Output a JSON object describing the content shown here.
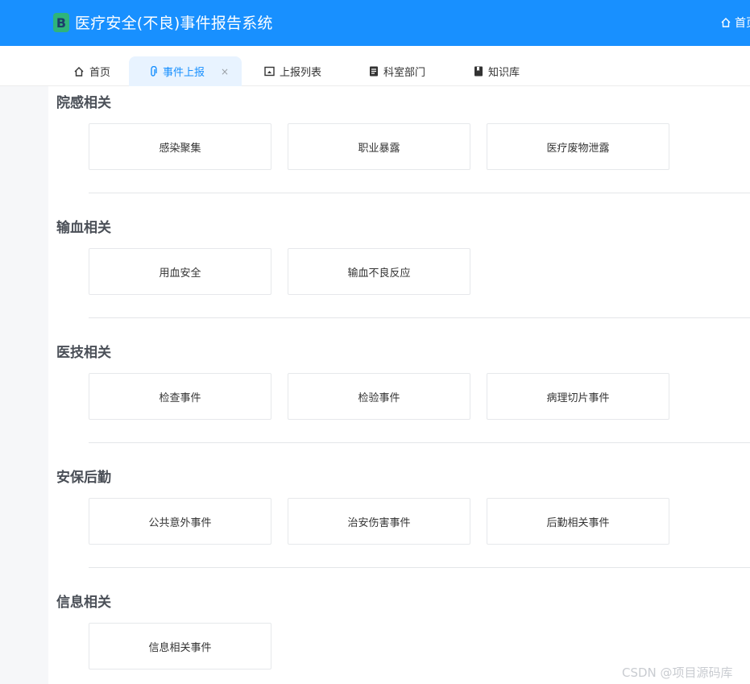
{
  "header": {
    "logo_letter": "B",
    "title": "医疗安全(不良)事件报告系统",
    "home_label": "首页"
  },
  "tabs": [
    {
      "label": "首页",
      "icon": "home-icon"
    },
    {
      "label": "事件上报",
      "icon": "paperclip-icon",
      "active": true,
      "close": "×"
    },
    {
      "label": "上报列表",
      "icon": "upload-icon"
    },
    {
      "label": "科室部门",
      "icon": "document-icon"
    },
    {
      "label": "知识库",
      "icon": "book-icon"
    }
  ],
  "sections": [
    {
      "title": "院感相关",
      "items": [
        "感染聚集",
        "职业暴露",
        "医疗废物泄露"
      ]
    },
    {
      "title": "输血相关",
      "items": [
        "用血安全",
        "输血不良反应"
      ]
    },
    {
      "title": "医技相关",
      "items": [
        "检查事件",
        "检验事件",
        "病理切片事件"
      ]
    },
    {
      "title": "安保后勤",
      "items": [
        "公共意外事件",
        "治安伤害事件",
        "后勤相关事件"
      ]
    },
    {
      "title": "信息相关",
      "items": [
        "信息相关事件"
      ]
    }
  ],
  "watermark": "CSDN @项目源码库",
  "colors": {
    "primary": "#1890ff",
    "active_tab_bg": "#e8f3ff",
    "logo": "#2fb47a"
  }
}
